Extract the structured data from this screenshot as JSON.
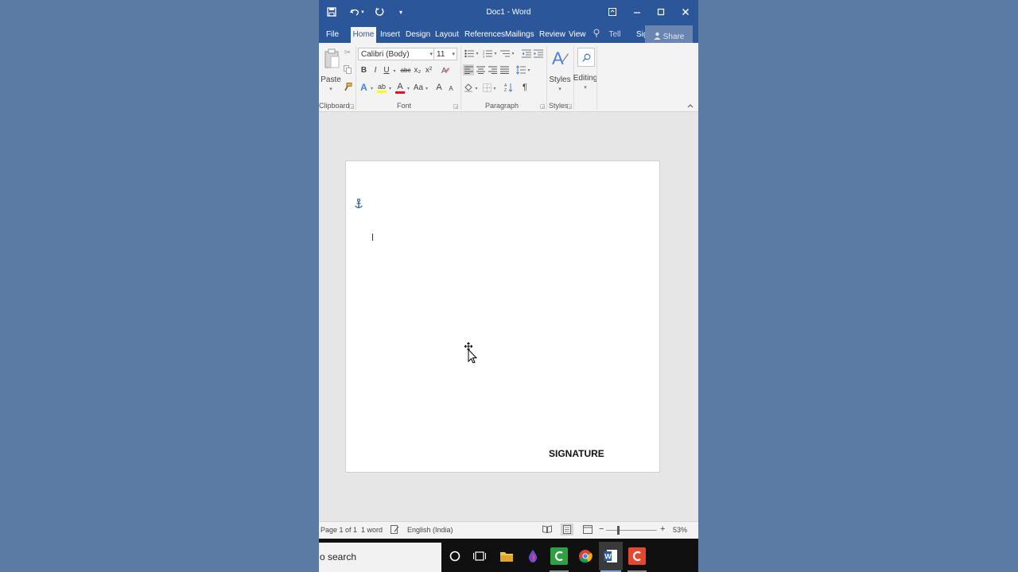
{
  "window": {
    "title": "Doc1 - Word",
    "quick_access": {
      "save_icon": "save-icon",
      "undo_icon": "undo-icon",
      "redo_icon": "redo-icon",
      "customize_icon": "customize-qat-icon"
    },
    "controls": {
      "ribbon_display": "ribbon-display-options-icon",
      "minimize": "minimize-icon",
      "maximize": "maximize-icon",
      "close": "close-icon"
    }
  },
  "tabs": [
    {
      "label": "File",
      "active": false
    },
    {
      "label": "Home",
      "active": true
    },
    {
      "label": "Insert",
      "active": false
    },
    {
      "label": "Design",
      "active": false
    },
    {
      "label": "Layout",
      "active": false
    },
    {
      "label": "References",
      "active": false
    },
    {
      "label": "Mailings",
      "active": false
    },
    {
      "label": "Review",
      "active": false
    },
    {
      "label": "View",
      "active": false
    }
  ],
  "tell_me": "Tell me...",
  "sign_in": "Sign in",
  "share": "Share",
  "ribbon": {
    "clipboard": {
      "label": "Clipboard",
      "paste": "Paste"
    },
    "font": {
      "label": "Font",
      "font_name": "Calibri (Body)",
      "font_size": "11",
      "bold": "B",
      "italic": "I",
      "underline": "U",
      "strike": "abc",
      "subscript": "x₂",
      "superscript": "x²",
      "text_effects": "A",
      "highlight": "ab",
      "font_color": "A",
      "change_case": "Aa",
      "grow": "A",
      "shrink": "A"
    },
    "paragraph": {
      "label": "Paragraph",
      "pilcrow": "¶"
    },
    "styles": {
      "label": "Styles",
      "button": "Styles"
    },
    "editing": {
      "button": "Editing"
    }
  },
  "document": {
    "signature_text": "SIGNATURE"
  },
  "status": {
    "page": "Page 1 of 1",
    "words": "1 word",
    "language": "English (India)",
    "zoom": "53%"
  },
  "taskbar": {
    "search_text": "o search"
  },
  "colors": {
    "word_blue": "#2b579a",
    "desktop": "#5b7aa4",
    "highlight_yellow": "#ffff00",
    "font_red": "#e81123"
  }
}
